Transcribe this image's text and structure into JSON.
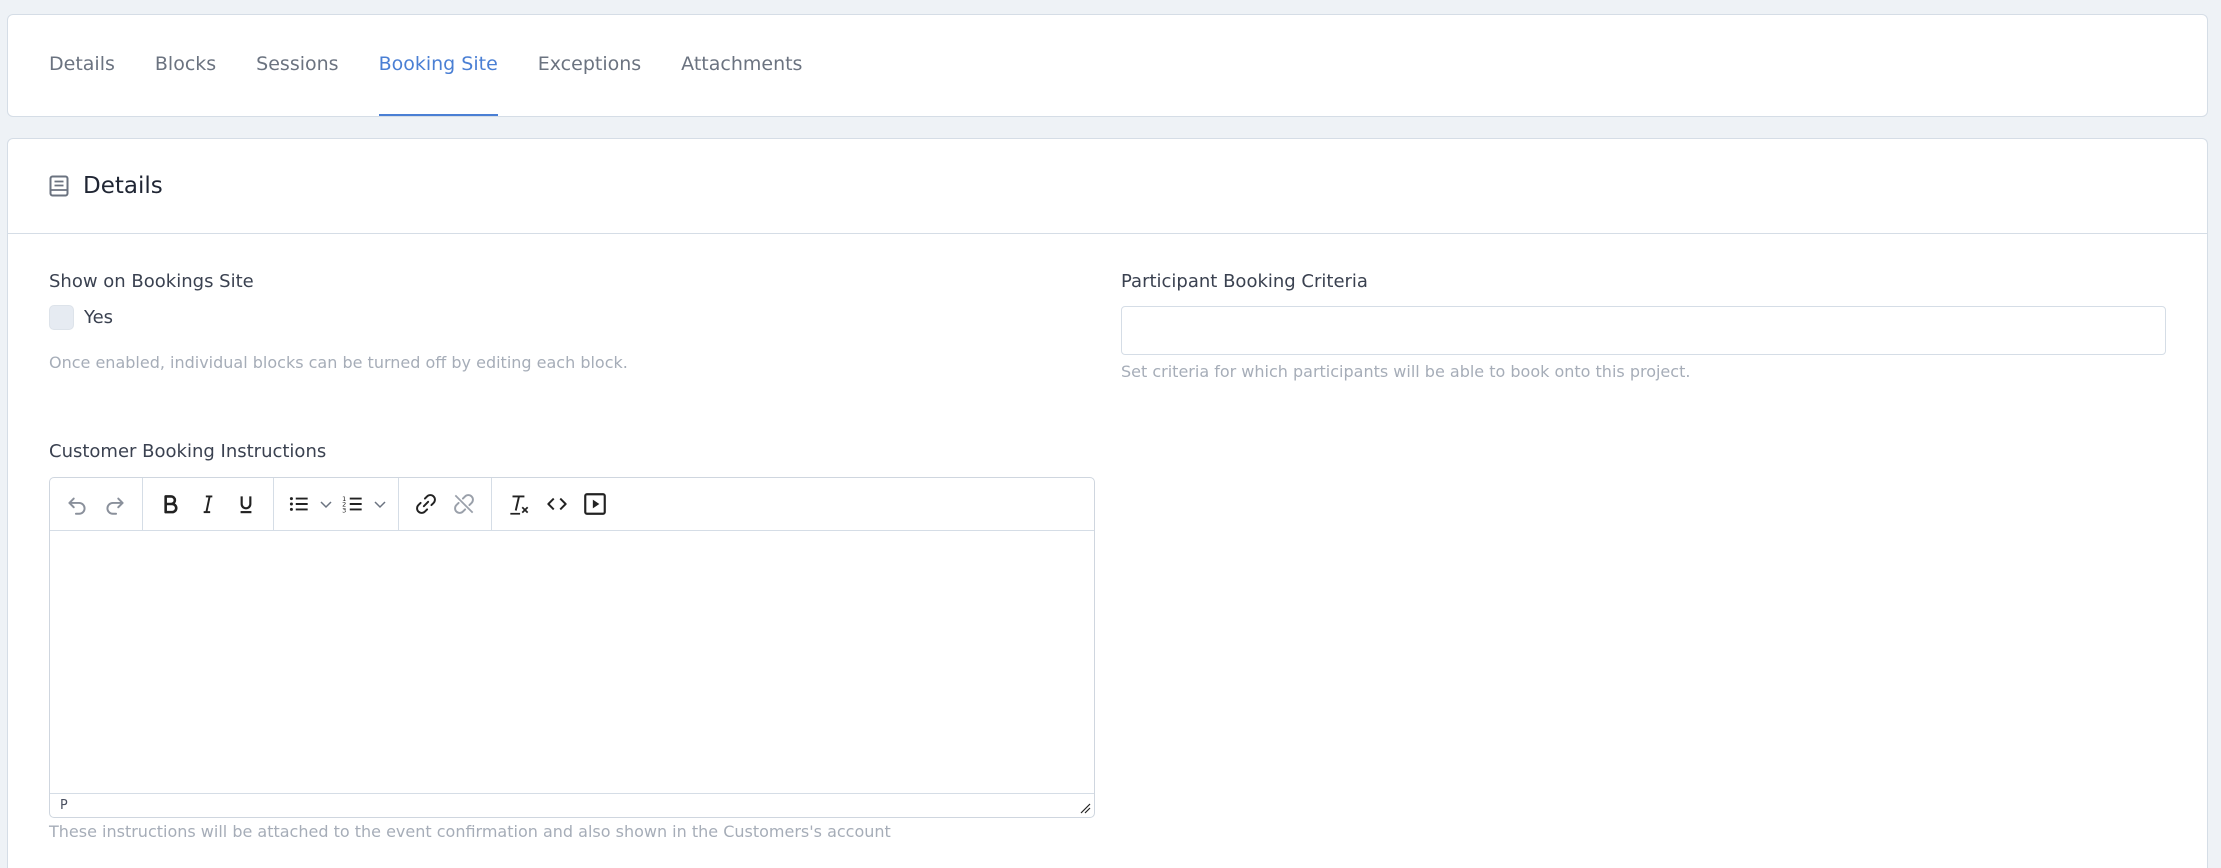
{
  "tabs": [
    {
      "label": "Details",
      "active": false
    },
    {
      "label": "Blocks",
      "active": false
    },
    {
      "label": "Sessions",
      "active": false
    },
    {
      "label": "Booking Site",
      "active": true
    },
    {
      "label": "Exceptions",
      "active": false
    },
    {
      "label": "Attachments",
      "active": false
    }
  ],
  "section": {
    "title": "Details",
    "icon": "document-icon"
  },
  "show_on_site": {
    "label": "Show on Bookings Site",
    "checkbox_label": "Yes",
    "checked": false,
    "help": "Once enabled, individual blocks can be turned off by editing each block."
  },
  "criteria": {
    "label": "Participant Booking Criteria",
    "value": "",
    "help": "Set criteria for which participants will be able to book onto this project."
  },
  "instructions": {
    "label": "Customer Booking Instructions",
    "status_path": "P",
    "help": "These instructions will be attached to the event confirmation and also shown in the Customers's account"
  },
  "toolbar": [
    "undo-icon",
    "redo-icon",
    "bold-icon",
    "italic-icon",
    "underline-icon",
    "bullet-list-icon",
    "numbered-list-icon",
    "link-icon",
    "unlink-icon",
    "clear-formatting-icon",
    "source-code-icon",
    "media-icon"
  ],
  "colors": {
    "accent": "#4a7fd4",
    "background": "#eef2f6",
    "border": "#d5dde6",
    "help_text": "#a6adb8"
  }
}
